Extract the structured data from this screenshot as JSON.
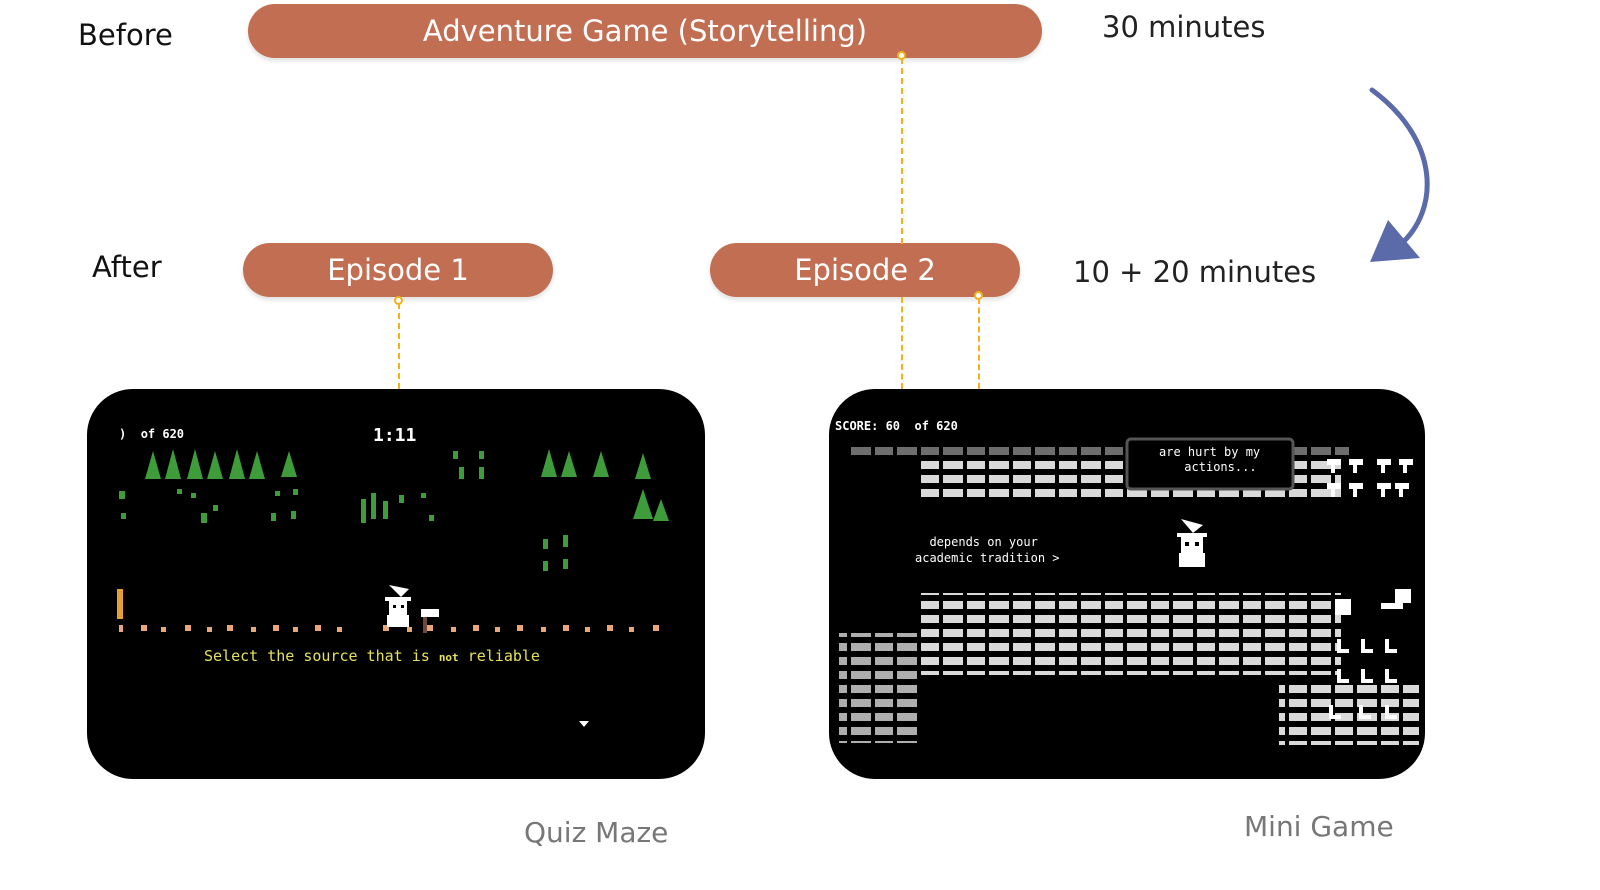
{
  "before": {
    "label": "Before",
    "pill": "Adventure Game (Storytelling)",
    "time": "30 minutes"
  },
  "after": {
    "label": "After",
    "episode1": "Episode 1",
    "episode2": "Episode 2",
    "time": "10 + 20 minutes"
  },
  "quiz_maze": {
    "caption": "Quiz Maze",
    "hud_left": "of 620",
    "timer": "1:11",
    "question_prefix": "Select the source that is",
    "question_emphasis": "not",
    "question_suffix": "reliable"
  },
  "mini_game": {
    "caption": "Mini Game",
    "score": "SCORE: 60",
    "of": "of 620",
    "sign_line1": "are hurt by my",
    "sign_line2": "actions...",
    "text_line1": "depends on your",
    "text_line2": "academic tradition >"
  },
  "colors": {
    "pill": "#c26e52",
    "connector": "#f2b21b",
    "arrow": "#5b6aa8",
    "quiz_text": "#e6e15a",
    "tree": "#3f9c3a",
    "path": "#e8a77a"
  },
  "icons": [
    "curved-arrow-icon",
    "player-sprite-icon",
    "down-triangle-icon"
  ]
}
